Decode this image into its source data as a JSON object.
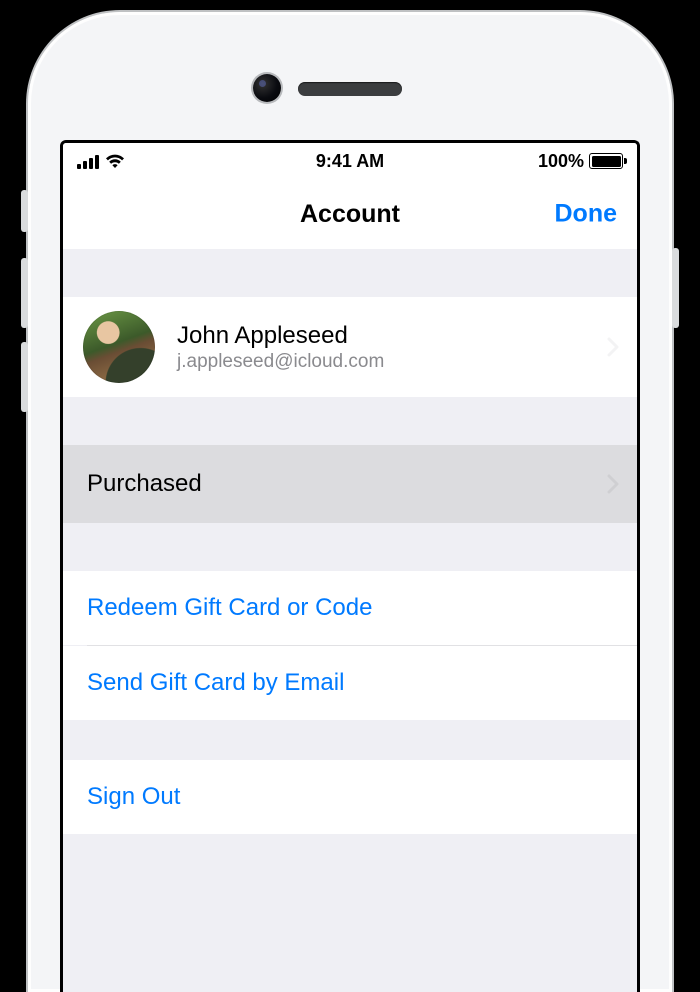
{
  "status": {
    "time": "9:41 AM",
    "battery_text": "100%"
  },
  "nav": {
    "title": "Account",
    "done_label": "Done"
  },
  "profile": {
    "name": "John Appleseed",
    "email": "j.appleseed@icloud.com"
  },
  "rows": {
    "purchased_label": "Purchased",
    "redeem_label": "Redeem Gift Card or Code",
    "send_gift_label": "Send Gift Card by Email",
    "sign_out_label": "Sign Out"
  }
}
